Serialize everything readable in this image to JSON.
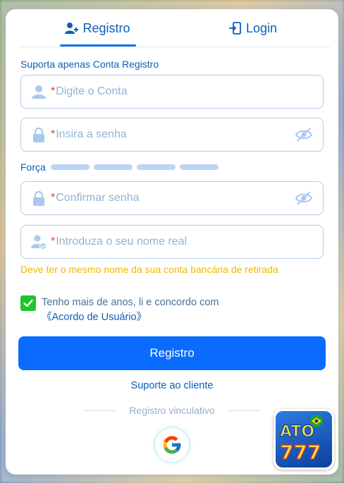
{
  "tabs": {
    "register_label": "Registro",
    "login_label": "Login"
  },
  "form": {
    "support_hint": "Suporta apenas Conta Registro",
    "account_placeholder": "Digite o Conta",
    "password_placeholder": "Insira a senha",
    "strength_label": "Força",
    "confirm_placeholder": "Confirmar senha",
    "realname_placeholder": "Introduza o seu nome real",
    "realname_warning": "Deve ter o mesmo nome da sua conta bancária de retirada",
    "required_mark": "*"
  },
  "agreement": {
    "text": "Tenho mais de anos, li e concordo com ",
    "link": "《Acordo de Usuário》",
    "checked": true
  },
  "actions": {
    "register_button": "Registro",
    "support_link": "Suporte ao cliente",
    "bind_divider": "Registro vinculativo"
  },
  "logo": {
    "text_top": "ATO",
    "text_bottom": "777"
  },
  "colors": {
    "accent": "#0a6cff",
    "link": "#0b5fb8",
    "warning": "#f0b800",
    "checkbox": "#1fc42c",
    "required": "#e53935"
  },
  "icons": {
    "register_tab": "user-plus-icon",
    "login_tab": "login-door-icon",
    "account": "user-icon",
    "password": "lock-icon",
    "eye_hidden": "eye-off-icon",
    "realname": "user-check-icon",
    "google": "google-icon"
  }
}
